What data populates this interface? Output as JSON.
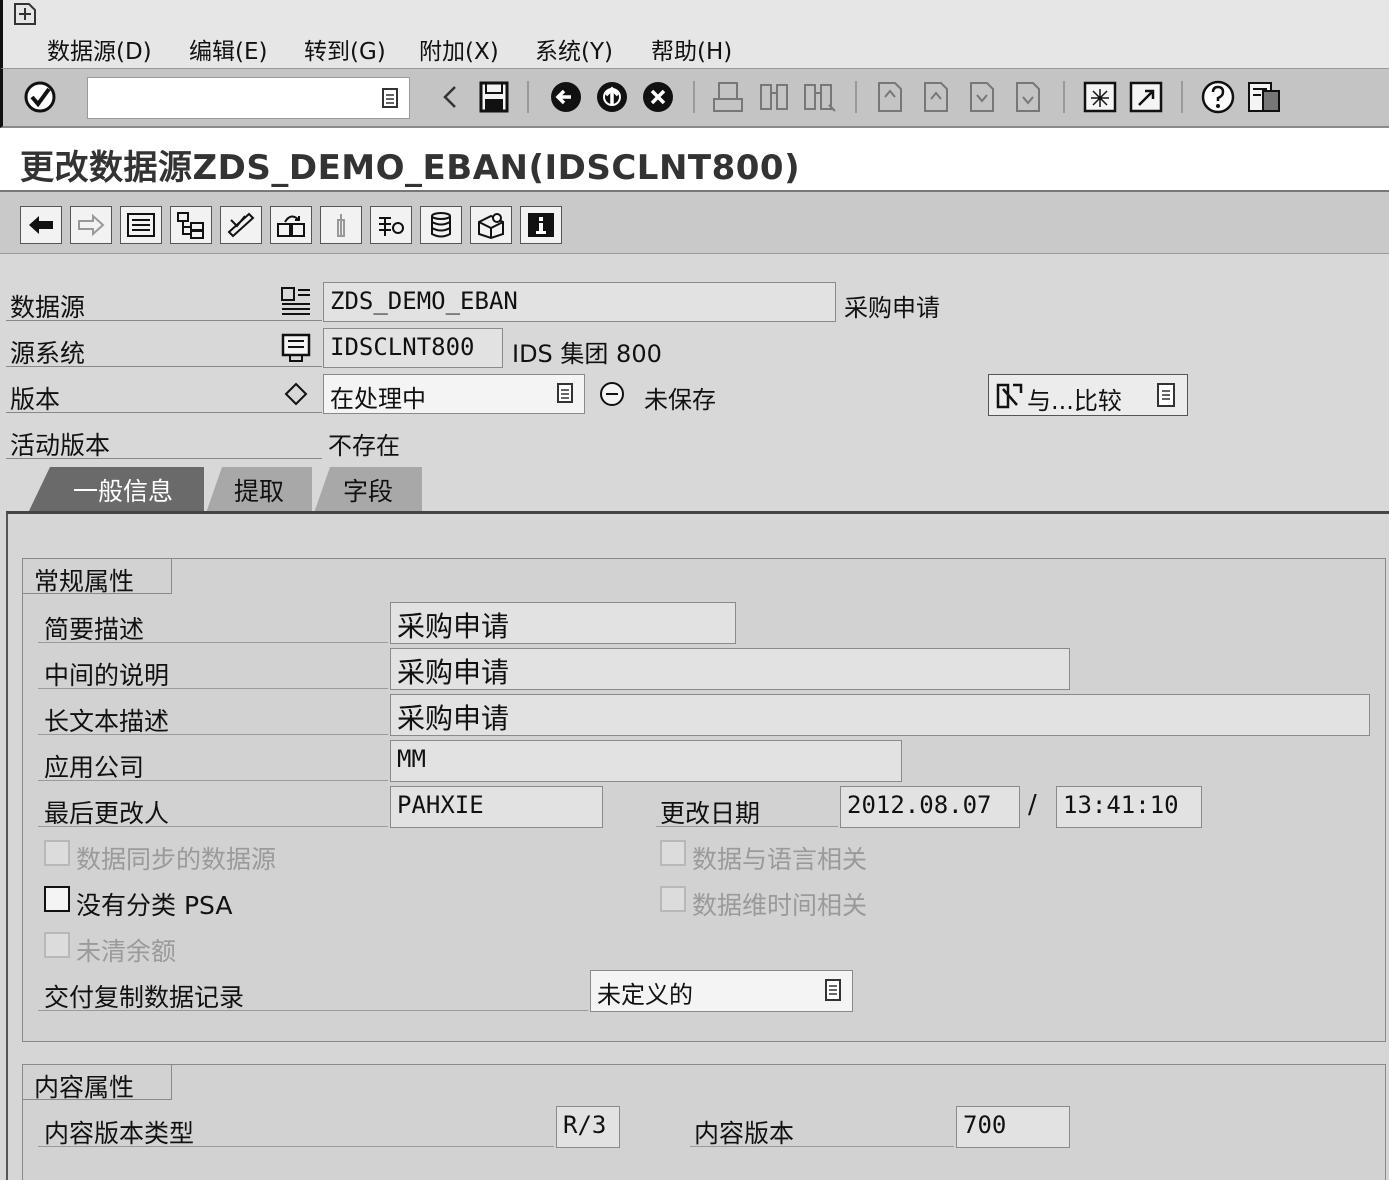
{
  "menubar": {
    "items": [
      {
        "label": "数据源(D)"
      },
      {
        "label": "编辑(E)"
      },
      {
        "label": "转到(G)"
      },
      {
        "label": "附加(X)"
      },
      {
        "label": "系统(Y)"
      },
      {
        "label": "帮助(H)"
      }
    ]
  },
  "toolbar": {
    "command_field_value": ""
  },
  "title": "更改数据源ZDS_DEMO_EBAN(IDSCLNT800)",
  "header": {
    "datasource": {
      "label": "数据源",
      "value": "ZDS_DEMO_EBAN",
      "description": "采购申请"
    },
    "source_system": {
      "label": "源系统",
      "value": "IDSCLNT800",
      "description": "IDS 集团 800"
    },
    "version": {
      "label": "版本",
      "value": "在处理中",
      "status": "未保存"
    },
    "active_version": {
      "label": "活动版本",
      "value": "不存在"
    },
    "compare_button": "与...比较"
  },
  "tabs": [
    {
      "label": "一般信息",
      "active": true
    },
    {
      "label": "提取",
      "active": false
    },
    {
      "label": "字段",
      "active": false
    }
  ],
  "general_attributes": {
    "title": "常规属性",
    "short_description": {
      "label": "简要描述",
      "value": "采购申请"
    },
    "medium_description": {
      "label": "中间的说明",
      "value": "采购申请"
    },
    "long_description": {
      "label": "长文本描述",
      "value": "采购申请"
    },
    "application_component": {
      "label": "应用公司",
      "value": "MM"
    },
    "last_changed_by": {
      "label": "最后更改人",
      "value": "PAHXIE"
    },
    "changed_on": {
      "label": "更改日期",
      "date": "2012.08.07",
      "separator": "/",
      "time": "13:41:10"
    },
    "checkboxes": {
      "realtime_enabled": {
        "label": "数据同步的数据源",
        "checked": false,
        "enabled": false
      },
      "no_psa_partitioning": {
        "label": "没有分类 PSA",
        "checked": false,
        "enabled": true
      },
      "open_amounts": {
        "label": "未清余额",
        "checked": false,
        "enabled": false
      },
      "language_dependent": {
        "label": "数据与语言相关",
        "checked": false,
        "enabled": false
      },
      "time_dependent": {
        "label": "数据维时间相关",
        "checked": false,
        "enabled": false
      }
    },
    "delivery_of_duplicates": {
      "label": "交付复制数据记录",
      "value": "未定义的"
    }
  },
  "content_attributes": {
    "title": "内容属性",
    "content_release_type": {
      "label": "内容版本类型",
      "value": "R/3"
    },
    "content_release": {
      "label": "内容版本",
      "value": "700"
    }
  },
  "icons": {
    "toolbar": [
      "enter-icon",
      "back-icon",
      "save-icon",
      "back-nav-icon",
      "exit-icon",
      "cancel-icon",
      "print-icon",
      "find-icon",
      "find-next-icon",
      "first-page-icon",
      "previous-page-icon",
      "next-page-icon",
      "last-page-icon",
      "new-session-icon",
      "shortcut-icon",
      "help-icon",
      "layout-icon"
    ]
  }
}
